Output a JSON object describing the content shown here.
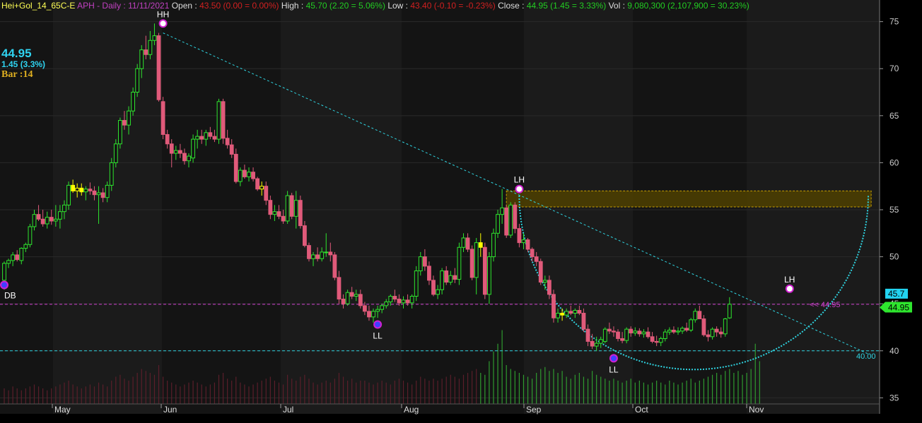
{
  "header": {
    "symbol": "Hei+Gol_14_65C-E",
    "title": "APH - Daily : 11/11/2021",
    "open_label": "Open :",
    "open_value": "43.50 (0.00 = 0.00%)",
    "high_label": "High :",
    "high_value": "45.70 (2.20 = 5.06%)",
    "low_label": "Low :",
    "low_value": "43.40 (-0.10 = -0.23%)",
    "close_label": "Close :",
    "close_value": "44.95 (1.45 = 3.33%)",
    "vol_label": "Vol :",
    "vol_value": "9,080,300 (2,107,900 = 30.23%)"
  },
  "overlay": {
    "last_price": "44.95",
    "change": "1.45 (3.3%)",
    "bar": "Bar :14"
  },
  "colors": {
    "background": "#000000",
    "up_candle": "#2ee52e",
    "down_candle": "#e05a7a",
    "inside_candle": "#ffff00",
    "trendline": "#2fd3e0",
    "zone_fill": "#4d4000",
    "zone_border": "#c8a000",
    "price_line": "#d040d0",
    "grid": "#2a2a2a",
    "volume": "#2a8a2a"
  },
  "chart_data": {
    "type": "candlestick",
    "ylim": [
      33,
      77
    ],
    "y_ticks": [
      "35",
      "40",
      "45",
      "50",
      "55",
      "60",
      "65",
      "70",
      "75"
    ],
    "x_labels": [
      "May",
      "Jun",
      "Jul",
      "Aug",
      "Sep",
      "Oct",
      "Nov"
    ],
    "last_value_label": "45.7",
    "current_price_label": "44.95",
    "price_line_label": "<< 44.95",
    "support_label": "40.00",
    "support_level": 40.0,
    "price_line_level": 44.95,
    "pivots": [
      {
        "label": "DB",
        "bar": 0,
        "price": 47.0
      },
      {
        "label": "HH",
        "bar": 37,
        "price": 74.8
      },
      {
        "label": "LL",
        "bar": 87,
        "price": 42.8
      },
      {
        "label": "LH",
        "bar": 120,
        "price": 57.2
      },
      {
        "label": "LL",
        "bar": 142,
        "price": 39.2
      },
      {
        "label": "LH",
        "bar": 183,
        "price": 46.6
      }
    ],
    "resistance_zone": {
      "from_bar": 117,
      "to_bar": 202,
      "low": 55.3,
      "high": 57.0
    },
    "candles": [
      [
        47.5,
        49.5,
        46.5,
        49.3
      ],
      [
        49.3,
        49.8,
        48.8,
        49.6
      ],
      [
        49.6,
        50.5,
        49.0,
        50.2
      ],
      [
        50.2,
        50.7,
        49.5,
        49.7
      ],
      [
        49.6,
        51.0,
        49.2,
        50.9
      ],
      [
        50.9,
        51.5,
        50.5,
        51.3
      ],
      [
        51.3,
        53.5,
        51.0,
        53.2
      ],
      [
        53.2,
        55.0,
        52.8,
        54.5
      ],
      [
        54.5,
        55.5,
        53.8,
        54.0
      ],
      [
        54.0,
        55.0,
        53.2,
        53.5
      ],
      [
        53.5,
        54.8,
        53.0,
        54.2
      ],
      [
        54.2,
        55.0,
        53.4,
        53.8
      ],
      [
        53.8,
        55.5,
        53.2,
        54.0
      ],
      [
        54.0,
        55.5,
        53.0,
        54.8
      ],
      [
        54.8,
        56.0,
        54.0,
        55.5
      ],
      [
        55.5,
        58.0,
        55.0,
        57.6
      ],
      [
        57.6,
        58.2,
        56.8,
        57.0
      ],
      [
        57.0,
        57.8,
        56.3,
        57.3
      ],
      [
        57.3,
        57.8,
        56.5,
        56.9
      ],
      [
        56.9,
        57.5,
        56.0,
        57.2
      ],
      [
        57.2,
        57.9,
        56.6,
        57.0
      ],
      [
        57.0,
        57.5,
        56.0,
        56.6
      ],
      [
        56.6,
        57.5,
        53.5,
        56.8
      ],
      [
        56.8,
        57.3,
        55.8,
        56.3
      ],
      [
        56.3,
        58.0,
        55.8,
        57.6
      ],
      [
        57.6,
        60.5,
        57.0,
        60.0
      ],
      [
        60.0,
        62.5,
        59.5,
        62.0
      ],
      [
        62.0,
        64.8,
        61.5,
        64.5
      ],
      [
        64.5,
        65.5,
        63.5,
        64.0
      ],
      [
        64.0,
        66.0,
        63.0,
        65.5
      ],
      [
        65.5,
        68.0,
        65.0,
        67.5
      ],
      [
        67.5,
        70.5,
        67.0,
        70.0
      ],
      [
        70.0,
        72.5,
        69.0,
        72.0
      ],
      [
        72.0,
        73.5,
        71.0,
        71.5
      ],
      [
        71.5,
        74.0,
        71.0,
        73.0
      ],
      [
        73.0,
        74.8,
        72.5,
        73.5
      ],
      [
        73.5,
        73.8,
        66.5,
        66.7
      ],
      [
        66.5,
        67.0,
        62.5,
        63.0
      ],
      [
        63.0,
        63.5,
        61.5,
        62.0
      ],
      [
        62.0,
        62.5,
        59.5,
        61.0
      ],
      [
        61.0,
        61.8,
        60.3,
        61.3
      ],
      [
        61.3,
        62.0,
        60.5,
        61.0
      ],
      [
        61.0,
        61.5,
        59.8,
        60.2
      ],
      [
        60.2,
        61.0,
        59.5,
        60.7
      ],
      [
        60.5,
        63.0,
        60.0,
        62.5
      ],
      [
        62.5,
        63.5,
        61.5,
        62.8
      ],
      [
        62.8,
        63.5,
        62.0,
        62.5
      ],
      [
        62.5,
        63.5,
        61.8,
        63.2
      ],
      [
        63.2,
        63.8,
        62.5,
        62.8
      ],
      [
        62.8,
        63.5,
        62.2,
        62.5
      ],
      [
        62.5,
        66.8,
        62.0,
        66.5
      ],
      [
        66.5,
        66.8,
        62.0,
        62.6
      ],
      [
        62.6,
        63.5,
        61.5,
        61.9
      ],
      [
        61.9,
        62.5,
        60.5,
        60.9
      ],
      [
        60.9,
        61.5,
        57.8,
        58.0
      ],
      [
        58.0,
        59.5,
        57.5,
        59.2
      ],
      [
        59.2,
        59.8,
        58.3,
        58.5
      ],
      [
        58.5,
        59.5,
        58.0,
        59.0
      ],
      [
        59.0,
        59.5,
        58.0,
        58.3
      ],
      [
        58.3,
        58.5,
        57.0,
        57.2
      ],
      [
        57.2,
        58.0,
        56.5,
        57.5
      ],
      [
        57.5,
        58.0,
        55.5,
        56.0
      ],
      [
        56.0,
        56.5,
        54.0,
        54.5
      ],
      [
        54.5,
        55.5,
        53.8,
        54.8
      ],
      [
        54.8,
        55.5,
        54.0,
        54.3
      ],
      [
        54.3,
        55.0,
        53.5,
        53.8
      ],
      [
        53.8,
        57.0,
        53.5,
        56.5
      ],
      [
        56.5,
        56.8,
        54.0,
        54.3
      ],
      [
        54.3,
        57.0,
        53.0,
        56.0
      ],
      [
        56.0,
        56.5,
        53.0,
        53.3
      ],
      [
        53.3,
        53.8,
        51.0,
        51.2
      ],
      [
        51.2,
        51.5,
        49.5,
        49.8
      ],
      [
        49.8,
        50.5,
        49.0,
        50.2
      ],
      [
        50.2,
        51.0,
        49.5,
        49.8
      ],
      [
        49.8,
        51.0,
        49.5,
        50.5
      ],
      [
        50.5,
        52.5,
        50.0,
        50.5
      ],
      [
        50.5,
        51.5,
        49.5,
        50.2
      ],
      [
        50.2,
        50.5,
        47.5,
        47.8
      ],
      [
        47.8,
        48.5,
        45.0,
        45.5
      ],
      [
        45.5,
        46.0,
        44.5,
        45.0
      ],
      [
        45.0,
        46.5,
        44.8,
        46.2
      ],
      [
        46.2,
        46.8,
        45.5,
        45.8
      ],
      [
        45.8,
        46.5,
        45.3,
        46.0
      ],
      [
        46.0,
        46.5,
        44.5,
        44.8
      ],
      [
        44.8,
        45.2,
        43.8,
        44.2
      ],
      [
        44.2,
        44.8,
        43.2,
        43.6
      ],
      [
        43.6,
        44.5,
        43.0,
        44.2
      ],
      [
        44.2,
        44.8,
        43.5,
        44.4
      ],
      [
        44.4,
        45.0,
        44.0,
        44.8
      ],
      [
        44.8,
        45.5,
        44.5,
        45.2
      ],
      [
        45.2,
        46.0,
        44.8,
        45.8
      ],
      [
        45.8,
        46.5,
        45.2,
        45.5
      ],
      [
        45.5,
        46.0,
        44.8,
        45.1
      ],
      [
        45.1,
        45.8,
        44.5,
        45.4
      ],
      [
        45.4,
        46.0,
        44.8,
        45.1
      ],
      [
        45.1,
        46.0,
        44.5,
        45.8
      ],
      [
        45.8,
        49.0,
        45.3,
        48.5
      ],
      [
        48.5,
        50.5,
        48.0,
        50.0
      ],
      [
        50.0,
        50.8,
        48.5,
        49.0
      ],
      [
        49.0,
        49.5,
        47.0,
        47.5
      ],
      [
        47.5,
        48.0,
        45.8,
        46.0
      ],
      [
        46.0,
        47.0,
        45.5,
        46.5
      ],
      [
        46.5,
        48.8,
        46.0,
        48.5
      ],
      [
        48.5,
        49.0,
        47.0,
        47.3
      ],
      [
        47.3,
        48.5,
        47.0,
        48.0
      ],
      [
        48.0,
        48.8,
        47.2,
        47.6
      ],
      [
        47.6,
        51.5,
        47.0,
        51.0
      ],
      [
        51.0,
        52.5,
        50.5,
        52.0
      ],
      [
        52.0,
        52.5,
        50.5,
        50.8
      ],
      [
        50.8,
        51.2,
        47.5,
        47.8
      ],
      [
        47.8,
        52.0,
        46.0,
        51.5
      ],
      [
        51.5,
        52.5,
        50.0,
        51.0
      ],
      [
        51.0,
        51.5,
        45.5,
        46.0
      ],
      [
        46.0,
        50.5,
        45.0,
        50.0
      ],
      [
        50.0,
        53.0,
        49.5,
        52.5
      ],
      [
        52.5,
        55.0,
        52.0,
        54.5
      ],
      [
        54.5,
        57.2,
        53.5,
        55.2
      ],
      [
        55.2,
        55.5,
        52.0,
        52.3
      ],
      [
        52.3,
        55.8,
        52.0,
        55.5
      ],
      [
        55.5,
        55.8,
        52.5,
        53.0
      ],
      [
        53.0,
        53.5,
        51.0,
        51.5
      ],
      [
        51.5,
        52.5,
        50.8,
        51.8
      ],
      [
        51.8,
        52.0,
        50.5,
        50.8
      ],
      [
        50.8,
        51.0,
        49.5,
        50.0
      ],
      [
        50.0,
        50.5,
        49.0,
        49.5
      ],
      [
        49.5,
        49.8,
        47.0,
        47.3
      ],
      [
        47.3,
        48.0,
        46.5,
        47.5
      ],
      [
        47.5,
        48.0,
        45.5,
        46.0
      ],
      [
        46.0,
        46.5,
        43.0,
        43.5
      ],
      [
        43.5,
        44.5,
        43.0,
        44.0
      ],
      [
        44.0,
        44.5,
        43.2,
        43.8
      ],
      [
        43.8,
        44.5,
        43.5,
        44.2
      ],
      [
        44.2,
        44.8,
        43.8,
        44.0
      ],
      [
        44.0,
        44.5,
        43.5,
        44.3
      ],
      [
        44.3,
        44.8,
        43.8,
        44.0
      ],
      [
        44.0,
        44.5,
        42.0,
        42.3
      ],
      [
        42.3,
        42.8,
        40.5,
        41.0
      ],
      [
        41.0,
        41.8,
        40.2,
        40.5
      ],
      [
        40.5,
        41.5,
        40.0,
        40.8
      ],
      [
        40.8,
        41.5,
        40.3,
        41.2
      ],
      [
        41.0,
        42.5,
        40.8,
        42.3
      ],
      [
        42.3,
        43.0,
        41.8,
        42.1
      ],
      [
        42.1,
        42.6,
        41.5,
        42.0
      ],
      [
        42.0,
        42.3,
        41.0,
        41.3
      ],
      [
        41.3,
        42.0,
        40.8,
        41.1
      ],
      [
        41.1,
        42.5,
        40.8,
        42.3
      ],
      [
        42.3,
        42.6,
        41.5,
        41.9
      ],
      [
        41.9,
        42.5,
        41.6,
        42.1
      ],
      [
        42.1,
        42.4,
        41.5,
        41.8
      ],
      [
        41.8,
        42.3,
        41.4,
        42.0
      ],
      [
        42.0,
        42.5,
        41.3,
        41.5
      ],
      [
        41.5,
        42.0,
        40.8,
        41.0
      ],
      [
        41.0,
        41.6,
        40.5,
        40.9
      ],
      [
        40.9,
        41.5,
        40.5,
        41.3
      ],
      [
        41.3,
        42.3,
        41.0,
        42.0
      ],
      [
        42.0,
        42.5,
        41.7,
        42.2
      ],
      [
        42.2,
        42.6,
        41.8,
        42.0
      ],
      [
        42.0,
        42.5,
        41.7,
        42.1
      ],
      [
        42.1,
        42.6,
        41.8,
        42.4
      ],
      [
        42.4,
        43.0,
        42.0,
        42.2
      ],
      [
        42.2,
        43.5,
        42.0,
        43.3
      ],
      [
        43.3,
        44.5,
        43.0,
        44.2
      ],
      [
        44.2,
        44.8,
        43.5,
        43.4
      ],
      [
        43.4,
        43.8,
        41.5,
        41.7
      ],
      [
        41.7,
        42.2,
        41.0,
        41.5
      ],
      [
        41.5,
        42.5,
        41.2,
        42.3
      ],
      [
        42.3,
        42.6,
        41.5,
        42.0
      ],
      [
        42.0,
        42.5,
        41.4,
        41.8
      ],
      [
        41.8,
        43.5,
        41.5,
        43.4
      ],
      [
        43.5,
        45.7,
        43.4,
        44.95
      ]
    ],
    "volumes": [
      8,
      7,
      9,
      8,
      7,
      8,
      9,
      10,
      9,
      8,
      7,
      8,
      9,
      10,
      11,
      12,
      10,
      9,
      8,
      9,
      10,
      9,
      11,
      10,
      9,
      12,
      14,
      15,
      13,
      12,
      14,
      16,
      18,
      17,
      16,
      15,
      20,
      14,
      12,
      11,
      10,
      9,
      10,
      11,
      12,
      11,
      10,
      9,
      10,
      11,
      15,
      16,
      13,
      12,
      14,
      11,
      10,
      9,
      10,
      11,
      12,
      13,
      14,
      12,
      11,
      10,
      15,
      13,
      12,
      14,
      15,
      13,
      11,
      10,
      11,
      12,
      11,
      13,
      16,
      14,
      12,
      13,
      11,
      12,
      12,
      11,
      10,
      11,
      12,
      11,
      10,
      12,
      13,
      12,
      11,
      10,
      12,
      14,
      13,
      12,
      13,
      12,
      13,
      14,
      15,
      14,
      13,
      15,
      16,
      17,
      18,
      16,
      15,
      22,
      27,
      31,
      38,
      20,
      18,
      17,
      16,
      15,
      14,
      13,
      16,
      18,
      19,
      17,
      18,
      16,
      17,
      14,
      13,
      15,
      16,
      14,
      13,
      17,
      15,
      14,
      13,
      12,
      13,
      12,
      11,
      12,
      13,
      11,
      12,
      11,
      10,
      11,
      12,
      11,
      10,
      12,
      11,
      10,
      11,
      12,
      13,
      11,
      12,
      13,
      14,
      15,
      16,
      15,
      17,
      18,
      16,
      17,
      15,
      16,
      18,
      31,
      22
    ]
  }
}
